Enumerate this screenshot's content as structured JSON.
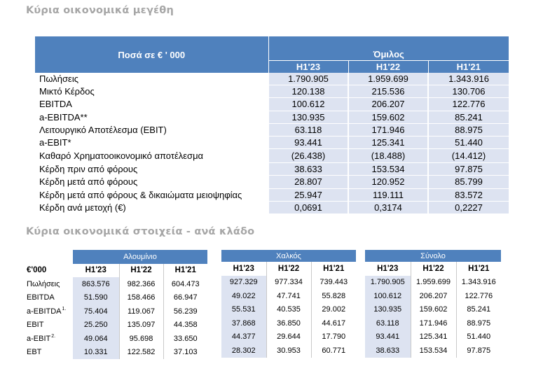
{
  "section1": {
    "title": "Κύρια οικονομικά μεγέθη",
    "amount_header": "Ποσά  σε € ' 000",
    "group": "Όμιλος",
    "periods": [
      "H1'23",
      "H1'22",
      "H1'21"
    ],
    "rows": [
      {
        "label": "Πωλήσεις",
        "values": [
          "1.790.905",
          "1.959.699",
          "1.343.916"
        ]
      },
      {
        "label": "Μικτό Κέρδος",
        "values": [
          "120.138",
          "215.536",
          "130.706"
        ]
      },
      {
        "label": "EBITDA",
        "values": [
          "100.612",
          "206.207",
          "122.776"
        ]
      },
      {
        "label": "a-EBITDA**",
        "values": [
          "130.935",
          "159.602",
          "85.241"
        ]
      },
      {
        "label": "Λειτουργικό Αποτέλεσμα (EBIT)",
        "values": [
          "63.118",
          "171.946",
          "88.975"
        ]
      },
      {
        "label": "a-EBIT*",
        "values": [
          "93.441",
          "125.341",
          "51.440"
        ]
      },
      {
        "label": "Καθαρό Χρηματοοικονομικό αποτέλεσμα",
        "values": [
          "(26.438)",
          "(18.488)",
          "(14.412)"
        ]
      },
      {
        "label": "Κέρδη πριν από φόρους",
        "values": [
          "38.633",
          "153.534",
          "97.875"
        ]
      },
      {
        "label": "Κέρδη μετά από φόρους",
        "values": [
          "28.807",
          "120.952",
          "85.799"
        ]
      },
      {
        "label": "Κέρδη μετά από φόρους & δικαιώματα μειοψηφίας",
        "values": [
          "25.947",
          "119.111",
          "83.572"
        ]
      },
      {
        "label": "Κέρδη ανά μετοχή (€)",
        "values": [
          "0,0691",
          "0,3174",
          "0,2227"
        ]
      }
    ]
  },
  "section2": {
    "title": "Κύρια οικονομικά στοιχεία - ανά κλάδο",
    "unit_label": "€'000",
    "periods": [
      "H1'23",
      "H1'22",
      "H1'21"
    ],
    "row_labels": [
      {
        "text": "Πωλήσεις",
        "sup": ""
      },
      {
        "text": "EBITDA",
        "sup": ""
      },
      {
        "text": "a-EBITDA",
        "sup": "1."
      },
      {
        "text": "EBIT",
        "sup": ""
      },
      {
        "text": "a-EBIT",
        "sup": "2."
      },
      {
        "text": "EBT",
        "sup": ""
      }
    ],
    "segments": [
      {
        "name": "Αλουμίνιο",
        "rows": [
          [
            "863.576",
            "982.366",
            "604.473"
          ],
          [
            "51.590",
            "158.466",
            "66.947"
          ],
          [
            "75.404",
            "119.067",
            "56.239"
          ],
          [
            "25.250",
            "135.097",
            "44.358"
          ],
          [
            "49.064",
            "95.698",
            "33.650"
          ],
          [
            "10.331",
            "122.582",
            "37.103"
          ]
        ]
      },
      {
        "name": "Χαλκός",
        "rows": [
          [
            "927.329",
            "977.334",
            "739.443"
          ],
          [
            "49.022",
            "47.741",
            "55.828"
          ],
          [
            "55.531",
            "40.535",
            "29.002"
          ],
          [
            "37.868",
            "36.850",
            "44.617"
          ],
          [
            "44.377",
            "29.644",
            "17.790"
          ],
          [
            "28.302",
            "30.953",
            "60.771"
          ]
        ]
      },
      {
        "name": "Σύνολο",
        "rows": [
          [
            "1.790.905",
            "1.959.699",
            "1.343.916"
          ],
          [
            "100.612",
            "206.207",
            "122.776"
          ],
          [
            "130.935",
            "159.602",
            "85.241"
          ],
          [
            "63.118",
            "171.946",
            "88.975"
          ],
          [
            "93.441",
            "125.341",
            "51.440"
          ],
          [
            "38.633",
            "153.534",
            "97.875"
          ]
        ]
      }
    ]
  }
}
